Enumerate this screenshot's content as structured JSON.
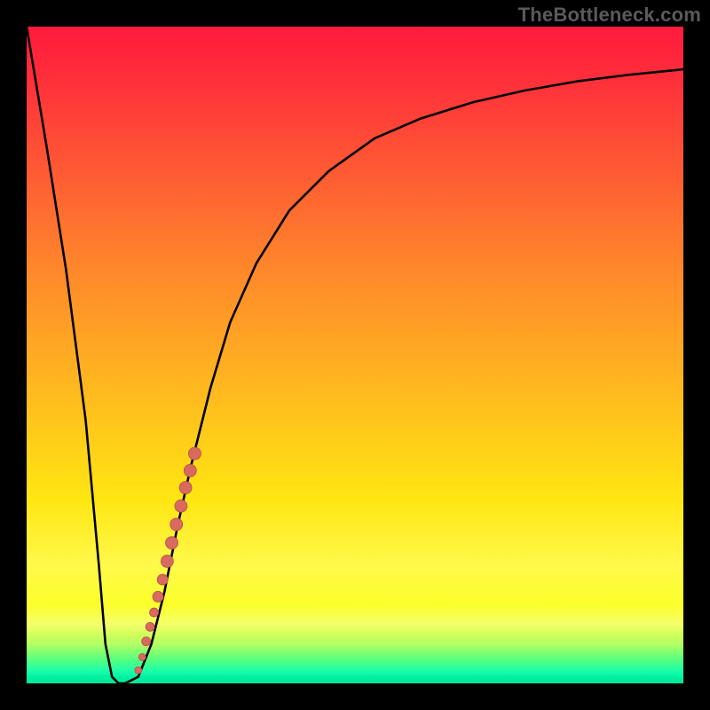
{
  "watermark": "TheBottleneck.com",
  "colors": {
    "curve": "#000000",
    "dots_fill": "#d86a60",
    "dots_stroke": "#b94f48",
    "frame": "#000000"
  },
  "chart_data": {
    "type": "line",
    "title": "",
    "xlabel": "",
    "ylabel": "",
    "xlim": [
      0,
      100
    ],
    "ylim": [
      0,
      100
    ],
    "grid": false,
    "series": [
      {
        "name": "bottleneck-curve",
        "x": [
          0,
          3,
          6,
          9,
          11,
          12,
          13,
          14,
          15,
          17,
          19,
          21,
          23,
          25,
          28,
          31,
          35,
          40,
          46,
          53,
          60,
          68,
          76,
          84,
          92,
          100
        ],
        "y": [
          100,
          82,
          63,
          40,
          18,
          6,
          1,
          0,
          0,
          1,
          6,
          14,
          24,
          33,
          45,
          55,
          64,
          72,
          78,
          83,
          86,
          88.5,
          90.3,
          91.7,
          92.7,
          93.5
        ]
      }
    ],
    "scatter": {
      "name": "highlighted-points",
      "points": [
        {
          "x": 17.0,
          "y": 2.0,
          "r": 4
        },
        {
          "x": 17.6,
          "y": 4.0,
          "r": 4
        },
        {
          "x": 18.2,
          "y": 6.4,
          "r": 5
        },
        {
          "x": 18.8,
          "y": 8.6,
          "r": 5
        },
        {
          "x": 19.4,
          "y": 10.8,
          "r": 5
        },
        {
          "x": 20.0,
          "y": 13.2,
          "r": 6
        },
        {
          "x": 20.7,
          "y": 15.8,
          "r": 6
        },
        {
          "x": 21.4,
          "y": 18.6,
          "r": 7
        },
        {
          "x": 22.1,
          "y": 21.4,
          "r": 7
        },
        {
          "x": 22.8,
          "y": 24.2,
          "r": 7
        },
        {
          "x": 23.5,
          "y": 27.0,
          "r": 7
        },
        {
          "x": 24.2,
          "y": 29.8,
          "r": 7
        },
        {
          "x": 24.9,
          "y": 32.4,
          "r": 7
        },
        {
          "x": 25.6,
          "y": 35.0,
          "r": 7
        }
      ]
    }
  }
}
